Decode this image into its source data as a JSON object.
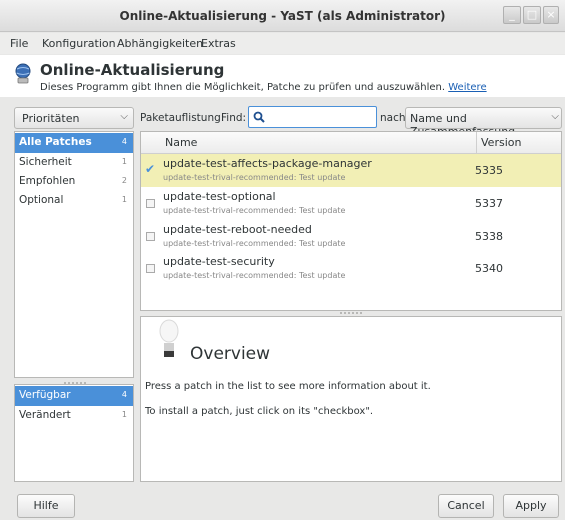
{
  "window": {
    "title": "Online-Aktualisierung - YaST (als Administrator)",
    "controls": [
      "_",
      "□",
      "×"
    ]
  },
  "menu": [
    "File",
    "Konfiguration",
    "Abhängigkeiten",
    "Extras"
  ],
  "header": {
    "icon": "update-globe-icon",
    "title": "Online-Aktualisierung",
    "subtitle": "Dieses Programm gibt Ihnen die Möglichkeit, Patche zu prüfen und auszuwählen.",
    "link": "Weitere"
  },
  "filter": {
    "combo": "Prioritäten",
    "arrow": "⌵"
  },
  "priorities": [
    {
      "label": "Alle Patches",
      "count": "4"
    },
    {
      "label": "Sicherheit",
      "count": "1"
    },
    {
      "label": "Empfohlen",
      "count": "2"
    },
    {
      "label": "Optional",
      "count": "1"
    }
  ],
  "status": [
    {
      "label": "Verfügbar",
      "count": "4"
    },
    {
      "label": "Verändert",
      "count": "1"
    }
  ],
  "search": {
    "listing_label": "Paketauflistung:",
    "find_label": "Find:",
    "value": "",
    "nach_label": "nach",
    "criteria": "Name und Zusammenfassung"
  },
  "table": {
    "columns": [
      "Name",
      "Version"
    ],
    "rows": [
      {
        "name": "update-test-affects-package-manager",
        "summary": "update-test-trival-recommended: Test update",
        "version": "5335",
        "checked": true
      },
      {
        "name": "update-test-optional",
        "summary": "update-test-trival-recommended: Test update",
        "version": "5337",
        "checked": false
      },
      {
        "name": "update-test-reboot-needed",
        "summary": "update-test-trival-recommended: Test update",
        "version": "5338",
        "checked": false
      },
      {
        "name": "update-test-security",
        "summary": "update-test-trival-recommended: Test update",
        "version": "5340",
        "checked": false
      }
    ]
  },
  "overview": {
    "icon": "lightbulb-icon",
    "title": "Overview",
    "line1": "Press a patch in the list to see more information about it.",
    "line2": "To install a patch, just click on its \"checkbox\"."
  },
  "buttons": {
    "help": "Hilfe",
    "cancel": "Cancel",
    "apply": "Apply"
  },
  "colors": {
    "selection": "#4a90d9",
    "selected_row": "#f2efb5",
    "link": "#1a5fb4"
  }
}
